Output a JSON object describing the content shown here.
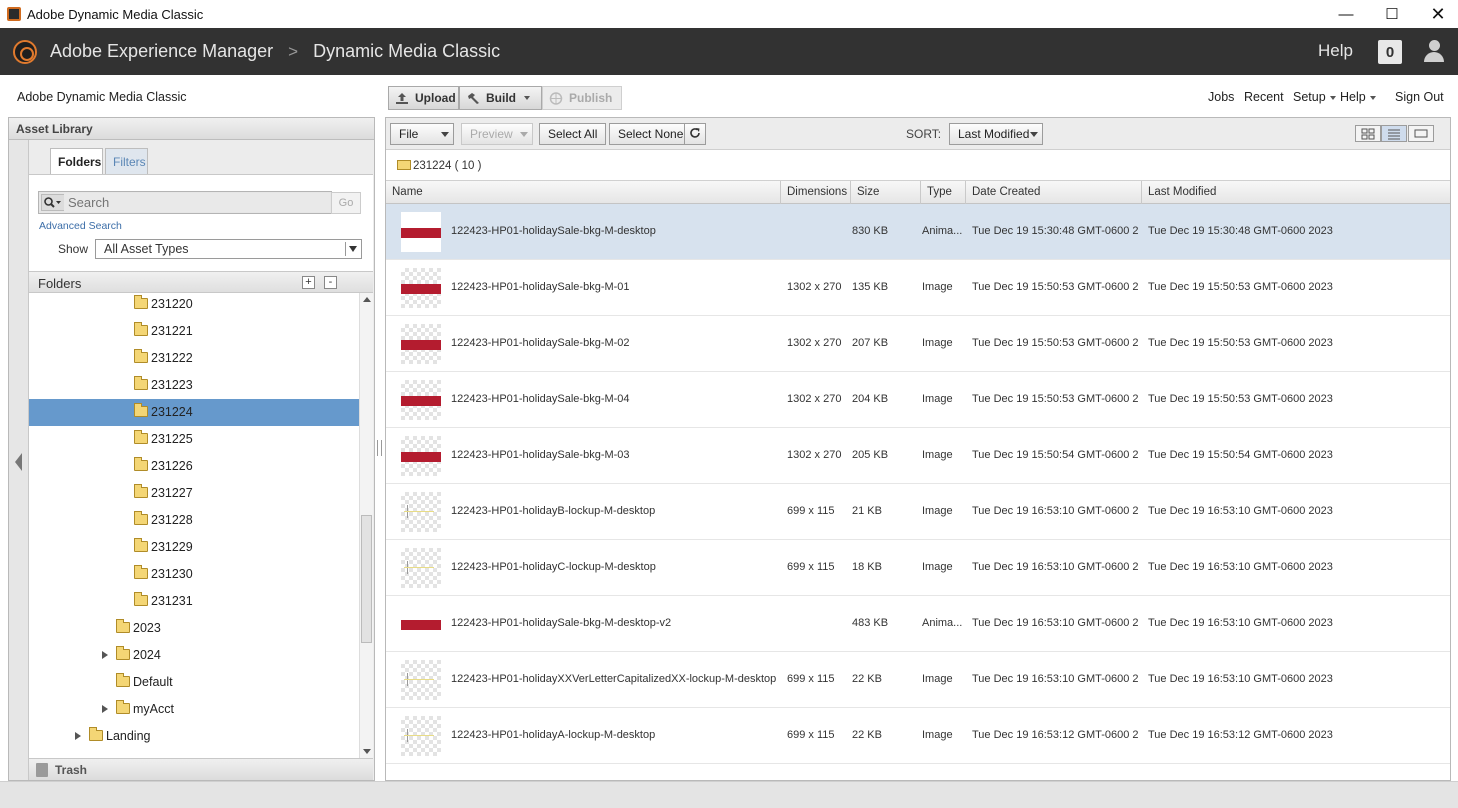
{
  "window": {
    "title": "Adobe Dynamic Media Classic",
    "controls": [
      "minimize-icon",
      "maximize-icon",
      "close-icon"
    ]
  },
  "aem_header": {
    "brand": "Adobe Experience Manager",
    "separator": ">",
    "product": "Dynamic Media Classic",
    "help": "Help",
    "notifications": "0"
  },
  "app_toolbar": {
    "app_name": "Adobe Dynamic Media Classic",
    "upload": "Upload",
    "build": "Build",
    "publish": "Publish",
    "nav": {
      "jobs": "Jobs",
      "recent": "Recent",
      "setup": "Setup",
      "help": "Help",
      "sign_out": "Sign Out"
    }
  },
  "asset_library": {
    "title": "Asset Library",
    "tabs": [
      "Folders",
      "Filters"
    ],
    "active_tab": "Folders",
    "search": {
      "placeholder": "Search",
      "go": "Go"
    },
    "advanced_search": "Advanced Search",
    "show_label": "Show",
    "show_value": "All Asset Types",
    "folders_header": "Folders",
    "add": "+",
    "remove": "-",
    "tree": [
      {
        "label": "231220",
        "level": 4,
        "expandable": false,
        "selected": false
      },
      {
        "label": "231221",
        "level": 4,
        "expandable": false,
        "selected": false
      },
      {
        "label": "231222",
        "level": 4,
        "expandable": false,
        "selected": false
      },
      {
        "label": "231223",
        "level": 4,
        "expandable": false,
        "selected": false
      },
      {
        "label": "231224",
        "level": 4,
        "expandable": false,
        "selected": true
      },
      {
        "label": "231225",
        "level": 4,
        "expandable": false,
        "selected": false
      },
      {
        "label": "231226",
        "level": 4,
        "expandable": false,
        "selected": false
      },
      {
        "label": "231227",
        "level": 4,
        "expandable": false,
        "selected": false
      },
      {
        "label": "231228",
        "level": 4,
        "expandable": false,
        "selected": false
      },
      {
        "label": "231229",
        "level": 4,
        "expandable": false,
        "selected": false
      },
      {
        "label": "231230",
        "level": 4,
        "expandable": false,
        "selected": false
      },
      {
        "label": "231231",
        "level": 4,
        "expandable": false,
        "selected": false
      },
      {
        "label": "2023",
        "level": 3,
        "expandable": false,
        "selected": false
      },
      {
        "label": "2024",
        "level": 3,
        "expandable": true,
        "selected": false
      },
      {
        "label": "Default",
        "level": 3,
        "expandable": false,
        "selected": false
      },
      {
        "label": "myAcct",
        "level": 3,
        "expandable": true,
        "selected": false
      },
      {
        "label": "Landing",
        "level": 2,
        "expandable": true,
        "selected": false,
        "icon": "folder"
      }
    ],
    "trash": "Trash"
  },
  "main_toolbar": {
    "file": "File",
    "preview": "Preview",
    "select_all": "Select All",
    "select_none": "Select None",
    "refresh": "refresh-icon",
    "sort_label": "SORT:",
    "sort_value": "Last Modified",
    "views": [
      "grid-view-icon",
      "list-view-icon",
      "detail-view-icon"
    ],
    "active_view": "list-view-icon"
  },
  "path": {
    "label": "231224 ( 10 )"
  },
  "columns": [
    "Name",
    "Dimensions",
    "Size",
    "Type",
    "Date Created",
    "Last Modified"
  ],
  "assets": [
    {
      "name": "122423-HP01-holidaySale-bkg-M-desktop",
      "dimensions": "",
      "size": "830 KB",
      "type": "Anima...",
      "created": "Tue  Dec 19 15:30:48 GMT-0600 2",
      "modified": "Tue  Dec 19 15:30:48 GMT-0600 2023",
      "thumb": "band-white",
      "selected": true
    },
    {
      "name": "122423-HP01-holidaySale-bkg-M-01",
      "dimensions": "1302 x 270",
      "size": "135 KB",
      "type": "Image",
      "created": "Tue  Dec 19 15:50:53 GMT-0600 2",
      "modified": "Tue  Dec 19 15:50:53 GMT-0600 2023",
      "thumb": "band-checker",
      "selected": false
    },
    {
      "name": "122423-HP01-holidaySale-bkg-M-02",
      "dimensions": "1302 x 270",
      "size": "207 KB",
      "type": "Image",
      "created": "Tue  Dec 19 15:50:53 GMT-0600 2",
      "modified": "Tue  Dec 19 15:50:53 GMT-0600 2023",
      "thumb": "band-checker",
      "selected": false
    },
    {
      "name": "122423-HP01-holidaySale-bkg-M-04",
      "dimensions": "1302 x 270",
      "size": "204 KB",
      "type": "Image",
      "created": "Tue  Dec 19 15:50:53 GMT-0600 2",
      "modified": "Tue  Dec 19 15:50:53 GMT-0600 2023",
      "thumb": "band-checker",
      "selected": false
    },
    {
      "name": "122423-HP01-holidaySale-bkg-M-03",
      "dimensions": "1302 x 270",
      "size": "205 KB",
      "type": "Image",
      "created": "Tue  Dec 19 15:50:54 GMT-0600 2",
      "modified": "Tue  Dec 19 15:50:54 GMT-0600 2023",
      "thumb": "band-checker",
      "selected": false
    },
    {
      "name": "122423-HP01-holidayB-lockup-M-desktop",
      "dimensions": "699 x 115",
      "size": "21 KB",
      "type": "Image",
      "created": "Tue  Dec 19 16:53:10 GMT-0600 2",
      "modified": "Tue  Dec 19 16:53:10 GMT-0600 2023",
      "thumb": "lockup-checker",
      "selected": false
    },
    {
      "name": "122423-HP01-holidayC-lockup-M-desktop",
      "dimensions": "699 x 115",
      "size": "18 KB",
      "type": "Image",
      "created": "Tue  Dec 19 16:53:10 GMT-0600 2",
      "modified": "Tue  Dec 19 16:53:10 GMT-0600 2023",
      "thumb": "lockup-checker",
      "selected": false
    },
    {
      "name": "122423-HP01-holidaySale-bkg-M-desktop-v2",
      "dimensions": "",
      "size": "483 KB",
      "type": "Anima...",
      "created": "Tue  Dec 19 16:53:10 GMT-0600 2",
      "modified": "Tue  Dec 19 16:53:10 GMT-0600 2023",
      "thumb": "band-white",
      "selected": false
    },
    {
      "name": "122423-HP01-holidayXXVerLetterCapitalizedXX-lockup-M-desktop",
      "dimensions": "699 x 115",
      "size": "22 KB",
      "type": "Image",
      "created": "Tue  Dec 19 16:53:10 GMT-0600 2",
      "modified": "Tue  Dec 19 16:53:10 GMT-0600 2023",
      "thumb": "lockup-checker",
      "selected": false
    },
    {
      "name": "122423-HP01-holidayA-lockup-M-desktop",
      "dimensions": "699 x 115",
      "size": "22 KB",
      "type": "Image",
      "created": "Tue  Dec 19 16:53:12 GMT-0600 2",
      "modified": "Tue  Dec 19 16:53:12 GMT-0600 2023",
      "thumb": "lockup-checker",
      "selected": false
    }
  ],
  "colors": {
    "header_bg": "#323232",
    "selection_blue": "#6699cc",
    "row_selected": "#d7e2ee",
    "brand_accent": "#e07a2e",
    "banner_red": "#b41c2f"
  }
}
